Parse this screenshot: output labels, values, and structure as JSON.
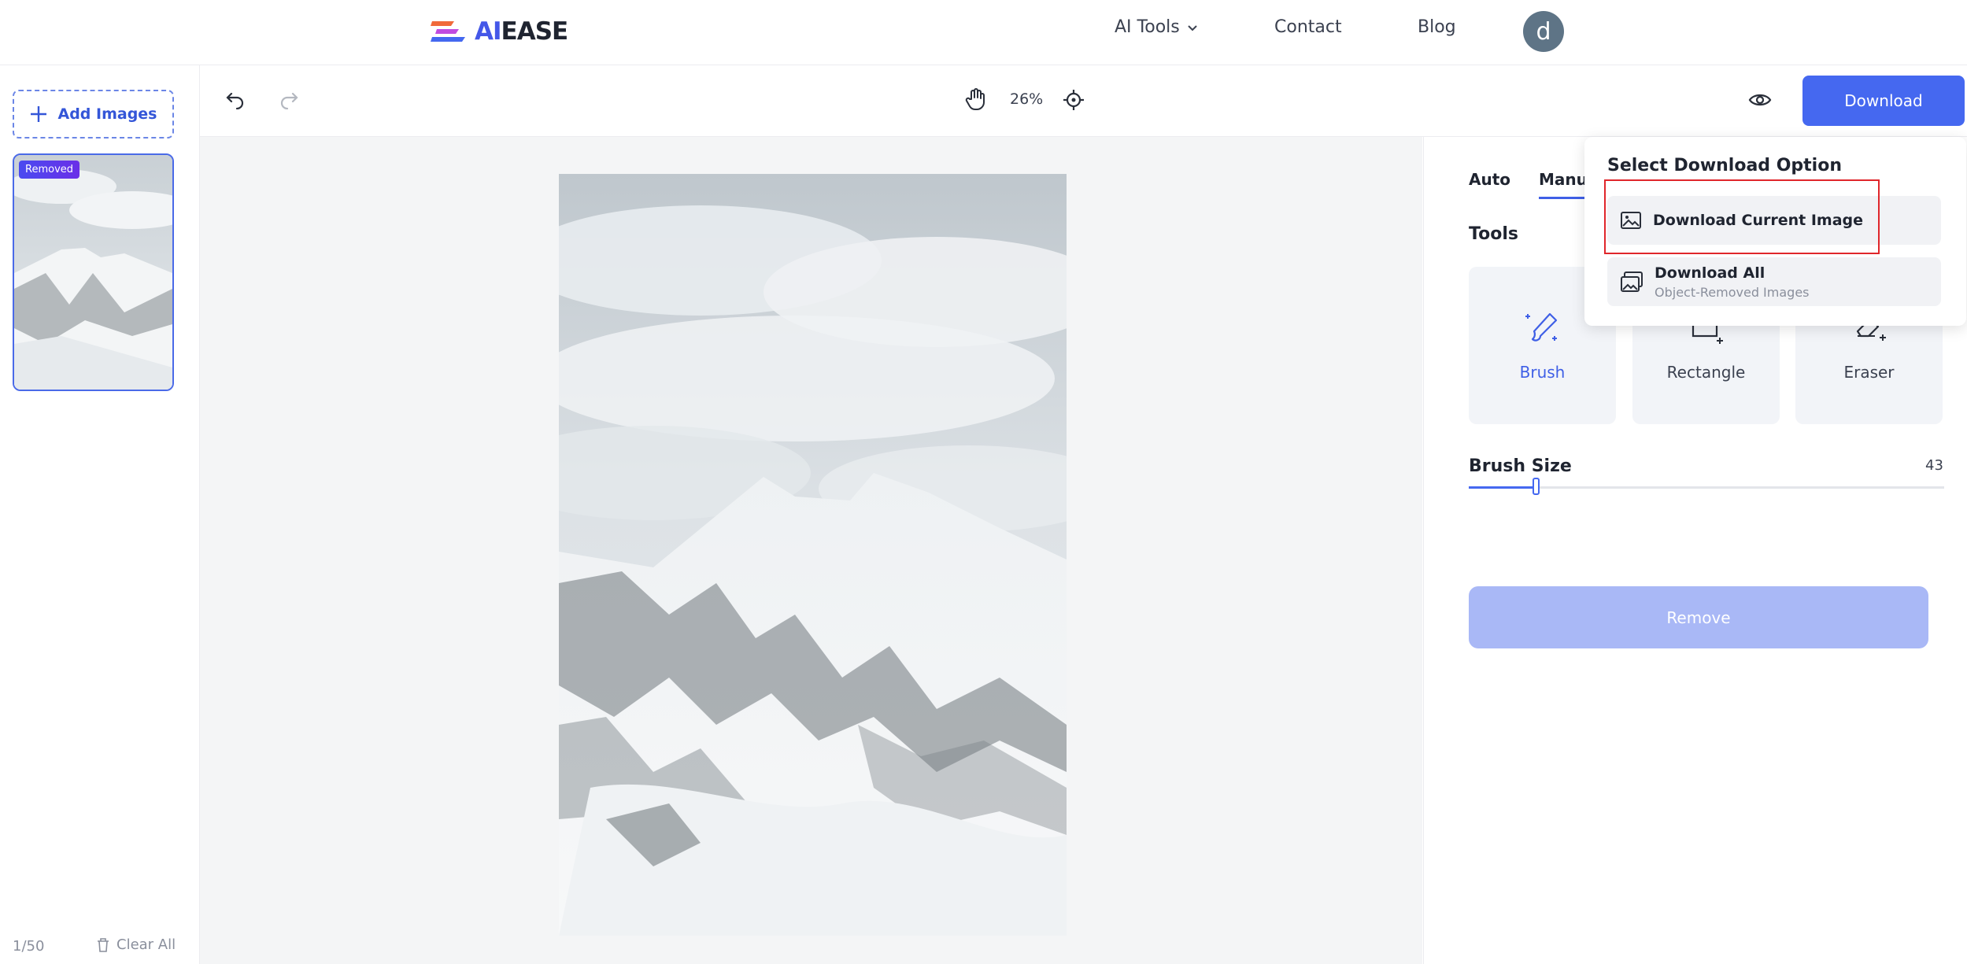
{
  "brand": {
    "logo_ai": "AI",
    "logo_rest": "EASE"
  },
  "nav": {
    "ai_tools": "AI Tools",
    "contact": "Contact",
    "blog": "Blog",
    "avatar_letter": "d"
  },
  "left": {
    "add_images": "Add Images",
    "badge": "Removed",
    "count": "1/50",
    "clear_all": "Clear All"
  },
  "toolbar": {
    "zoom": "26%",
    "download": "Download"
  },
  "panel": {
    "tabs": [
      "Auto",
      "Manual"
    ],
    "tools_title": "Tools",
    "tools": [
      {
        "label": "Brush",
        "icon": "brush-icon"
      },
      {
        "label": "Rectangle",
        "icon": "rectangle-icon"
      },
      {
        "label": "Eraser",
        "icon": "eraser-icon"
      }
    ],
    "brush_size_label": "Brush Size",
    "brush_size_value": "43",
    "brush_size_fraction": 0.09,
    "remove": "Remove"
  },
  "dropdown": {
    "title": "Select Download Option",
    "current": "Download Current Image",
    "all": "Download All",
    "all_sub": "Object-Removed Images"
  },
  "colors": {
    "accent": "#4568f0",
    "highlight": "#e0262b"
  }
}
